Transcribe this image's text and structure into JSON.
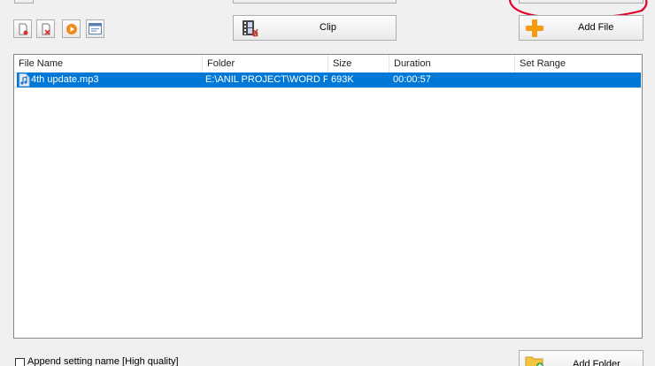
{
  "toolbar": {
    "clip_label": "Clip",
    "add_file_label": "Add File",
    "add_folder_label": "Add Folder",
    "small_buttons": [
      "new-document-icon",
      "delete-icon",
      "play-icon",
      "window-icon"
    ]
  },
  "file_list": {
    "columns": [
      "File Name",
      "Folder",
      "Size",
      "Duration",
      "Set Range"
    ],
    "rows": [
      {
        "file_name": "4th update.mp3",
        "folder": "E:\\ANIL PROJECT\\WORD P...",
        "size": "693K",
        "duration": "00:00:57",
        "set_range": ""
      }
    ]
  },
  "options": {
    "append_setting_label": "Append setting name [High quality]"
  },
  "colors": {
    "selection": "#0078d7",
    "annotation": "#e0002a",
    "add_icon": "#f39c12"
  }
}
